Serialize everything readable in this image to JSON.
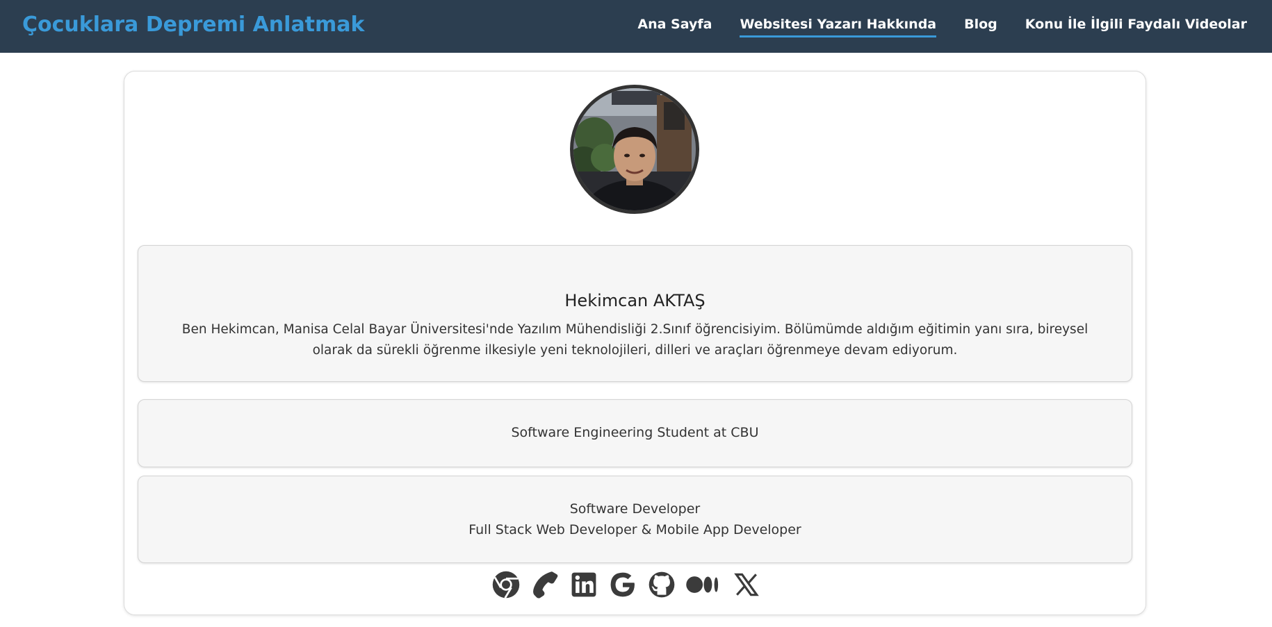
{
  "nav": {
    "brand": "Çocuklara Depremi Anlatmak",
    "links": [
      {
        "label": "Ana Sayfa",
        "active": false
      },
      {
        "label": "Websitesi Yazarı Hakkında",
        "active": true
      },
      {
        "label": "Blog",
        "active": false
      },
      {
        "label": "Konu İle İlgili Faydalı Videolar",
        "active": false
      }
    ]
  },
  "profile": {
    "name": "Hekimcan AKTAŞ",
    "bio": "Ben Hekimcan, Manisa Celal Bayar Üniversitesi'nde Yazılım Mühendisliği 2.Sınıf öğrencisiyim. Bölümümde aldığım eğitimin yanı sıra, bireysel olarak da sürekli öğrenme ilkesiyle yeni teknolojileri, dilleri ve araçları öğrenmeye devam ediyorum.",
    "role": "Software Engineering Student at CBU",
    "dev_title": "Software Developer",
    "dev_subtitle": "Full Stack Web Developer & Mobile App Developer"
  },
  "socials": [
    {
      "icon": "chrome-icon"
    },
    {
      "icon": "phone-icon"
    },
    {
      "icon": "linkedin-icon"
    },
    {
      "icon": "google-icon"
    },
    {
      "icon": "github-icon"
    },
    {
      "icon": "medium-icon"
    },
    {
      "icon": "x-twitter-icon"
    }
  ],
  "colors": {
    "navbar_bg": "#2c3e50",
    "brand": "#3a9ad9",
    "active_underline": "#3a9ad9",
    "icon": "#3b3b3b",
    "panel_bg": "#f6f6f6"
  }
}
